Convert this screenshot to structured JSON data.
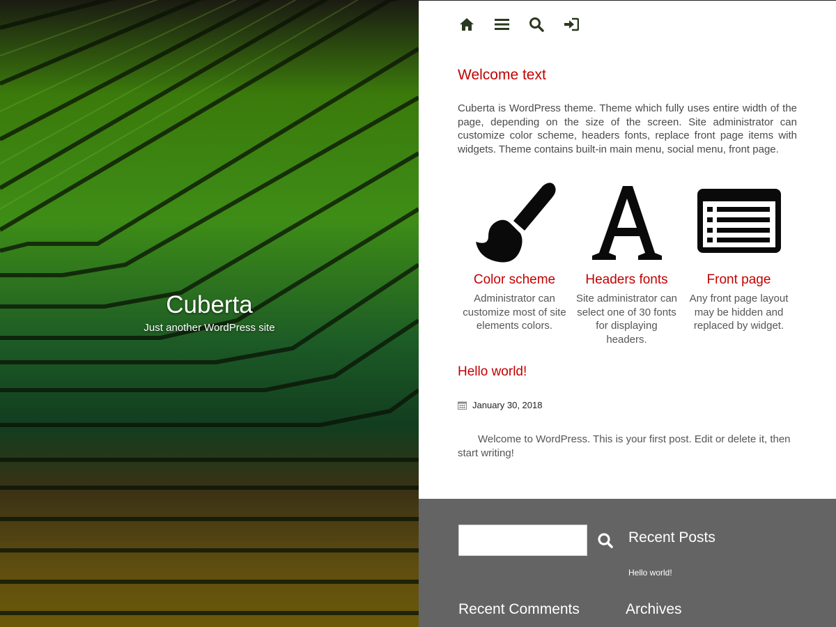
{
  "site": {
    "title": "Cuberta",
    "tagline": "Just another WordPress site"
  },
  "nav": {
    "icons": [
      "home-icon",
      "menu-icon",
      "search-icon",
      "login-icon"
    ],
    "icon_color": "#29391f"
  },
  "welcome": {
    "title": "Welcome text",
    "body": "Cuberta is WordPress theme. Theme which fully uses entire width of the page, depending on the size of the screen. Site administrator can customize color scheme, headers fonts, replace front page items with widgets. Theme contains built-in main menu, social menu, front page."
  },
  "features": [
    {
      "icon": "paintbrush-icon",
      "title": "Color scheme",
      "text": "Administrator can customize most of site elements colors."
    },
    {
      "icon": "font-letter-a-icon",
      "title": "Headers fonts",
      "text": "Site administrator can select one of 30 fonts for displaying headers."
    },
    {
      "icon": "list-window-icon",
      "title": "Front page",
      "text": "Any front page layout may be hidden and replaced by widget."
    }
  ],
  "post": {
    "title": "Hello world!",
    "date": "January 30, 2018",
    "excerpt": "Welcome to WordPress. This is your first post. Edit or delete it, then start writing!"
  },
  "footer": {
    "search_value": "",
    "recent_posts_title": "Recent Posts",
    "recent_posts": [
      "Hello world!"
    ],
    "recent_comments_title": "Recent Comments",
    "archives_title": "Archives"
  },
  "colors": {
    "accent": "#c20000",
    "footer_bg": "#646464",
    "text": "#4a4a4a"
  }
}
